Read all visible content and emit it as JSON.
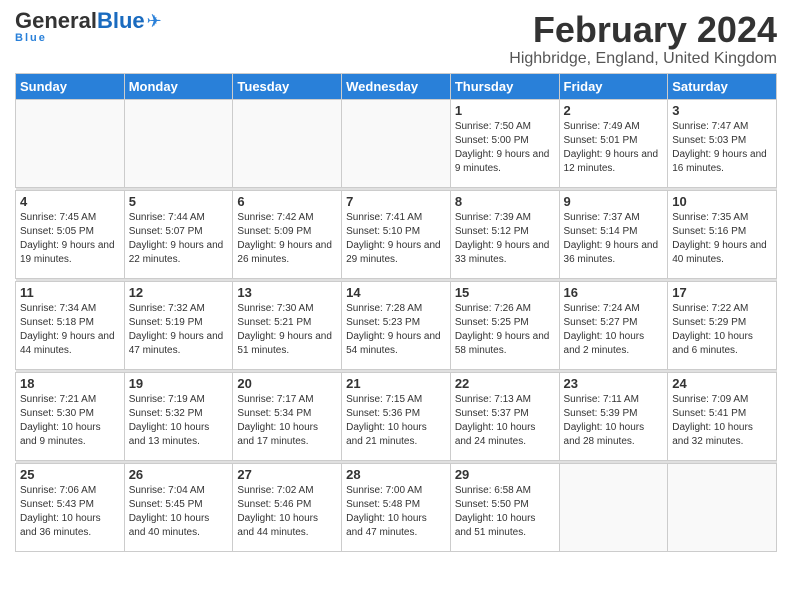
{
  "logo": {
    "general": "General",
    "blue": "Blue"
  },
  "title": "February 2024",
  "subtitle": "Highbridge, England, United Kingdom",
  "days_of_week": [
    "Sunday",
    "Monday",
    "Tuesday",
    "Wednesday",
    "Thursday",
    "Friday",
    "Saturday"
  ],
  "weeks": [
    [
      {
        "day": "",
        "info": ""
      },
      {
        "day": "",
        "info": ""
      },
      {
        "day": "",
        "info": ""
      },
      {
        "day": "",
        "info": ""
      },
      {
        "day": "1",
        "info": "Sunrise: 7:50 AM\nSunset: 5:00 PM\nDaylight: 9 hours\nand 9 minutes."
      },
      {
        "day": "2",
        "info": "Sunrise: 7:49 AM\nSunset: 5:01 PM\nDaylight: 9 hours\nand 12 minutes."
      },
      {
        "day": "3",
        "info": "Sunrise: 7:47 AM\nSunset: 5:03 PM\nDaylight: 9 hours\nand 16 minutes."
      }
    ],
    [
      {
        "day": "4",
        "info": "Sunrise: 7:45 AM\nSunset: 5:05 PM\nDaylight: 9 hours\nand 19 minutes."
      },
      {
        "day": "5",
        "info": "Sunrise: 7:44 AM\nSunset: 5:07 PM\nDaylight: 9 hours\nand 22 minutes."
      },
      {
        "day": "6",
        "info": "Sunrise: 7:42 AM\nSunset: 5:09 PM\nDaylight: 9 hours\nand 26 minutes."
      },
      {
        "day": "7",
        "info": "Sunrise: 7:41 AM\nSunset: 5:10 PM\nDaylight: 9 hours\nand 29 minutes."
      },
      {
        "day": "8",
        "info": "Sunrise: 7:39 AM\nSunset: 5:12 PM\nDaylight: 9 hours\nand 33 minutes."
      },
      {
        "day": "9",
        "info": "Sunrise: 7:37 AM\nSunset: 5:14 PM\nDaylight: 9 hours\nand 36 minutes."
      },
      {
        "day": "10",
        "info": "Sunrise: 7:35 AM\nSunset: 5:16 PM\nDaylight: 9 hours\nand 40 minutes."
      }
    ],
    [
      {
        "day": "11",
        "info": "Sunrise: 7:34 AM\nSunset: 5:18 PM\nDaylight: 9 hours\nand 44 minutes."
      },
      {
        "day": "12",
        "info": "Sunrise: 7:32 AM\nSunset: 5:19 PM\nDaylight: 9 hours\nand 47 minutes."
      },
      {
        "day": "13",
        "info": "Sunrise: 7:30 AM\nSunset: 5:21 PM\nDaylight: 9 hours\nand 51 minutes."
      },
      {
        "day": "14",
        "info": "Sunrise: 7:28 AM\nSunset: 5:23 PM\nDaylight: 9 hours\nand 54 minutes."
      },
      {
        "day": "15",
        "info": "Sunrise: 7:26 AM\nSunset: 5:25 PM\nDaylight: 9 hours\nand 58 minutes."
      },
      {
        "day": "16",
        "info": "Sunrise: 7:24 AM\nSunset: 5:27 PM\nDaylight: 10 hours\nand 2 minutes."
      },
      {
        "day": "17",
        "info": "Sunrise: 7:22 AM\nSunset: 5:29 PM\nDaylight: 10 hours\nand 6 minutes."
      }
    ],
    [
      {
        "day": "18",
        "info": "Sunrise: 7:21 AM\nSunset: 5:30 PM\nDaylight: 10 hours\nand 9 minutes."
      },
      {
        "day": "19",
        "info": "Sunrise: 7:19 AM\nSunset: 5:32 PM\nDaylight: 10 hours\nand 13 minutes."
      },
      {
        "day": "20",
        "info": "Sunrise: 7:17 AM\nSunset: 5:34 PM\nDaylight: 10 hours\nand 17 minutes."
      },
      {
        "day": "21",
        "info": "Sunrise: 7:15 AM\nSunset: 5:36 PM\nDaylight: 10 hours\nand 21 minutes."
      },
      {
        "day": "22",
        "info": "Sunrise: 7:13 AM\nSunset: 5:37 PM\nDaylight: 10 hours\nand 24 minutes."
      },
      {
        "day": "23",
        "info": "Sunrise: 7:11 AM\nSunset: 5:39 PM\nDaylight: 10 hours\nand 28 minutes."
      },
      {
        "day": "24",
        "info": "Sunrise: 7:09 AM\nSunset: 5:41 PM\nDaylight: 10 hours\nand 32 minutes."
      }
    ],
    [
      {
        "day": "25",
        "info": "Sunrise: 7:06 AM\nSunset: 5:43 PM\nDaylight: 10 hours\nand 36 minutes."
      },
      {
        "day": "26",
        "info": "Sunrise: 7:04 AM\nSunset: 5:45 PM\nDaylight: 10 hours\nand 40 minutes."
      },
      {
        "day": "27",
        "info": "Sunrise: 7:02 AM\nSunset: 5:46 PM\nDaylight: 10 hours\nand 44 minutes."
      },
      {
        "day": "28",
        "info": "Sunrise: 7:00 AM\nSunset: 5:48 PM\nDaylight: 10 hours\nand 47 minutes."
      },
      {
        "day": "29",
        "info": "Sunrise: 6:58 AM\nSunset: 5:50 PM\nDaylight: 10 hours\nand 51 minutes."
      },
      {
        "day": "",
        "info": ""
      },
      {
        "day": "",
        "info": ""
      }
    ]
  ]
}
